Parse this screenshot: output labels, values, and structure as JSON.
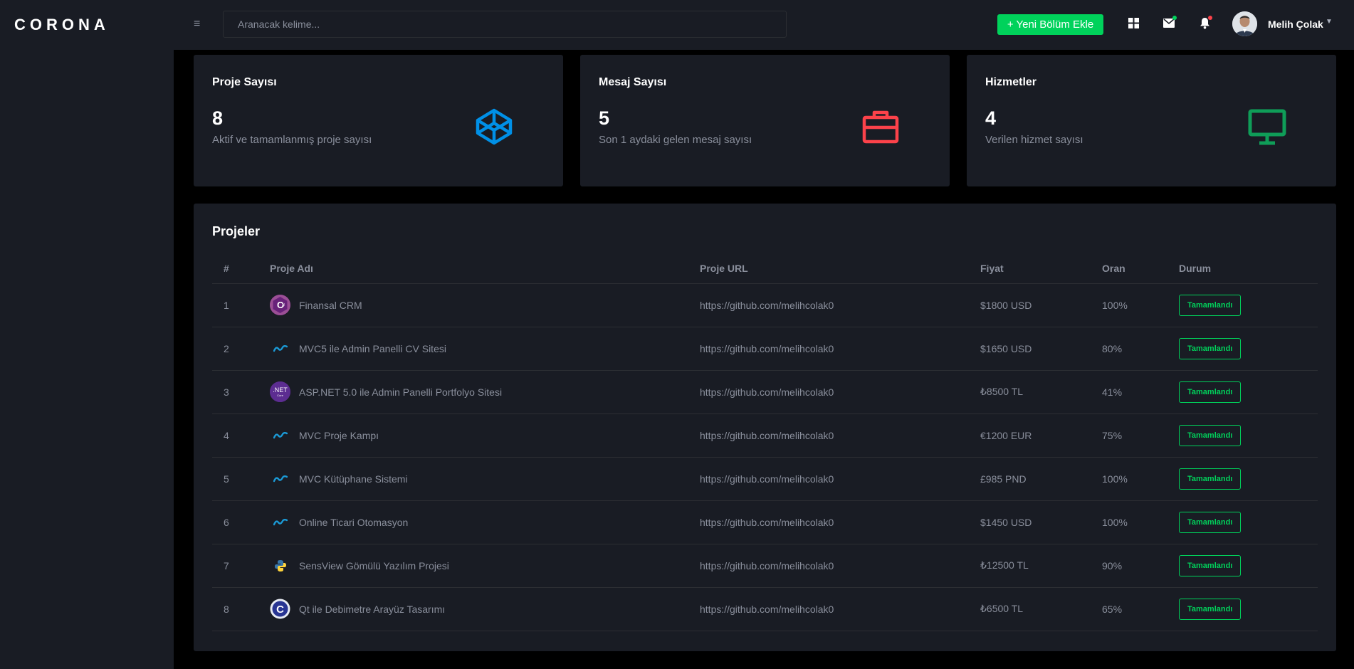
{
  "brand": "CORONA",
  "search": {
    "placeholder": "Aranacak kelime..."
  },
  "topbar": {
    "new_button": "+ Yeni Bölüm Ekle",
    "user_name": "Melih Çolak",
    "icons": [
      "view-grid-icon",
      "mail-icon",
      "bell-icon",
      "chevron-down-icon"
    ]
  },
  "colors": {
    "accent_green": "#00d25b",
    "blue": "#0090e7",
    "red": "#fc424a",
    "green_icon": "#00d25b",
    "bg_card": "#191c24"
  },
  "cards": [
    {
      "title": "Proje Sayısı",
      "value": "8",
      "desc": "Aktif ve tamamlanmış proje sayısı",
      "icon": "codepen-icon"
    },
    {
      "title": "Mesaj Sayısı",
      "value": "5",
      "desc": "Son 1 aydaki gelen mesaj sayısı",
      "icon": "briefcase-icon"
    },
    {
      "title": "Hizmetler",
      "value": "4",
      "desc": "Verilen hizmet sayısı",
      "icon": "monitor-icon"
    }
  ],
  "projects": {
    "title": "Projeler",
    "columns": [
      "#",
      "Proje Adı",
      "Proje URL",
      "Fiyat",
      "Oran",
      "Durum"
    ],
    "rows": [
      {
        "no": "1",
        "name": "Finansal CRM",
        "url": "https://github.com/melihcolak0",
        "price": "$1800 USD",
        "rate": "100%",
        "status": "Tamamlandı",
        "icon": "csharp-icon"
      },
      {
        "no": "2",
        "name": "MVC5 ile Admin Panelli CV Sitesi",
        "url": "https://github.com/melihcolak0",
        "price": "$1650 USD",
        "rate": "80%",
        "status": "Tamamlandı",
        "icon": "dotnet-mvc-icon"
      },
      {
        "no": "3",
        "name": "ASP.NET 5.0 ile Admin Panelli Portfolyo Sitesi",
        "url": "https://github.com/melihcolak0",
        "price": "₺8500 TL",
        "rate": "41%",
        "status": "Tamamlandı",
        "icon": "dotnet-core-icon"
      },
      {
        "no": "4",
        "name": "MVC Proje Kampı",
        "url": "https://github.com/melihcolak0",
        "price": "€1200 EUR",
        "rate": "75%",
        "status": "Tamamlandı",
        "icon": "dotnet-mvc-icon"
      },
      {
        "no": "5",
        "name": "MVC Kütüphane Sistemi",
        "url": "https://github.com/melihcolak0",
        "price": "£985 PND",
        "rate": "100%",
        "status": "Tamamlandı",
        "icon": "dotnet-mvc-icon"
      },
      {
        "no": "6",
        "name": "Online Ticari Otomasyon",
        "url": "https://github.com/melihcolak0",
        "price": "$1450 USD",
        "rate": "100%",
        "status": "Tamamlandı",
        "icon": "dotnet-mvc-icon"
      },
      {
        "no": "7",
        "name": "SensView Gömülü Yazılım Projesi",
        "url": "https://github.com/melihcolak0",
        "price": "₺12500 TL",
        "rate": "90%",
        "status": "Tamamlandı",
        "icon": "python-icon"
      },
      {
        "no": "8",
        "name": "Qt ile Debimetre Arayüz Tasarımı",
        "url": "https://github.com/melihcolak0",
        "price": "₺6500 TL",
        "rate": "65%",
        "status": "Tamamlandı",
        "icon": "c-language-icon"
      }
    ]
  }
}
